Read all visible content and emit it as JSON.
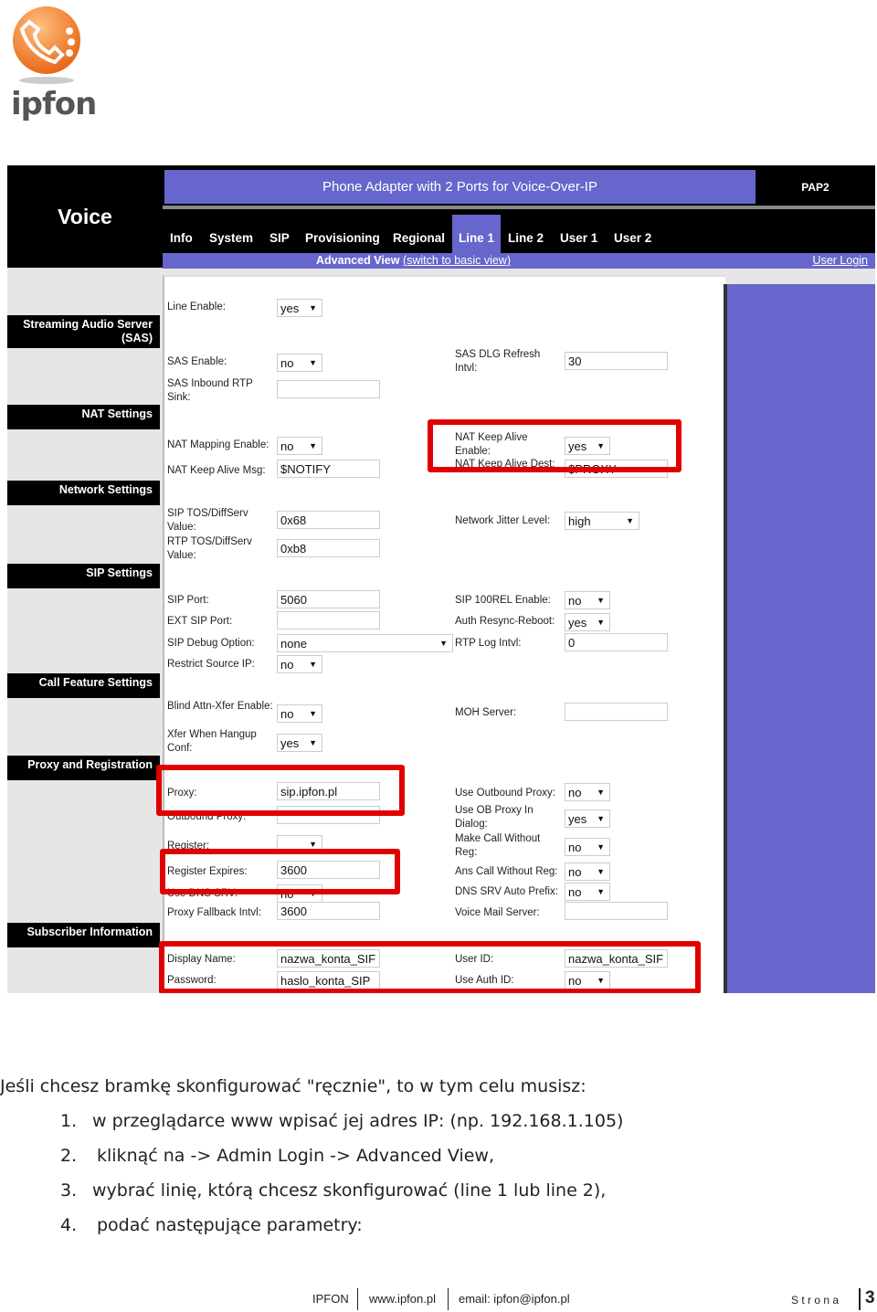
{
  "logo": {
    "text": "ipfon",
    "color": "#f08030"
  },
  "app": {
    "section_title": "Voice",
    "title": "Phone Adapter with 2 Ports for Voice-Over-IP",
    "model": "PAP2",
    "tabs": [
      {
        "label": "Info"
      },
      {
        "label": "System"
      },
      {
        "label": "SIP"
      },
      {
        "label": "Provisioning"
      },
      {
        "label": "Regional"
      },
      {
        "label": "Line 1",
        "active": true
      },
      {
        "label": "Line 2"
      },
      {
        "label": "User 1"
      },
      {
        "label": "User 2"
      }
    ],
    "view_label": "Advanced View",
    "switch_link": "(switch to basic view)",
    "user_login": "User Login",
    "accent": "#6666cc",
    "sections": [
      {
        "label": "Streaming Audio Server (SAS)"
      },
      {
        "label": "NAT Settings"
      },
      {
        "label": "Network Settings"
      },
      {
        "label": "SIP Settings"
      },
      {
        "label": "Call Feature Settings"
      },
      {
        "label": "Proxy and Registration"
      },
      {
        "label": "Subscriber Information"
      }
    ],
    "fields": [
      {
        "label": "Line Enable:",
        "value": "yes",
        "kind": "select"
      },
      {
        "label": "SAS Enable:",
        "value": "no",
        "kind": "select"
      },
      {
        "label": "SAS Inbound RTP Sink:",
        "value": "",
        "kind": "text"
      },
      {
        "label": "NAT Mapping Enable:",
        "value": "no",
        "kind": "select"
      },
      {
        "label": "NAT Keep Alive Msg:",
        "value": "$NOTIFY",
        "kind": "text"
      },
      {
        "label": "SIP TOS/DiffServ Value:",
        "value": "0x68",
        "kind": "text"
      },
      {
        "label": "RTP TOS/DiffServ Value:",
        "value": "0xb8",
        "kind": "text"
      },
      {
        "label": "SIP Port:",
        "value": "5060",
        "kind": "text"
      },
      {
        "label": "EXT SIP Port:",
        "value": "",
        "kind": "text"
      },
      {
        "label": "SIP Debug Option:",
        "value": "none",
        "kind": "select"
      },
      {
        "label": "Restrict Source IP:",
        "value": "no",
        "kind": "select"
      },
      {
        "label": "Blind Attn-Xfer Enable:",
        "value": "no",
        "kind": "select"
      },
      {
        "label": "Xfer When Hangup Conf:",
        "value": "yes",
        "kind": "select"
      },
      {
        "label": "Proxy:",
        "value": "sip.ipfon.pl",
        "kind": "text"
      },
      {
        "label": "Outbound Proxy:",
        "value": "",
        "kind": "text"
      },
      {
        "label": "Register:",
        "value": "",
        "kind": "select"
      },
      {
        "label": "Register Expires:",
        "value": "3600",
        "kind": "text"
      },
      {
        "label": "Use DNS SRV:",
        "value": "no",
        "kind": "select"
      },
      {
        "label": "Proxy Fallback Intvl:",
        "value": "3600",
        "kind": "text"
      },
      {
        "label": "Display Name:",
        "value": "nazwa_konta_SIF",
        "kind": "text"
      },
      {
        "label": "Password:",
        "value": "haslo_konta_SIP",
        "kind": "text"
      },
      {
        "label": "SAS DLG Refresh Intvl:",
        "value": "30",
        "kind": "text"
      },
      {
        "label": "NAT Keep Alive Enable:",
        "value": "yes",
        "kind": "select"
      },
      {
        "label": "NAT Keep Alive Dest:",
        "value": "$PROXY",
        "kind": "text"
      },
      {
        "label": "Network Jitter Level:",
        "value": "high",
        "kind": "select"
      },
      {
        "label": "SIP 100REL Enable:",
        "value": "no",
        "kind": "select"
      },
      {
        "label": "Auth Resync-Reboot:",
        "value": "yes",
        "kind": "select"
      },
      {
        "label": "RTP Log Intvl:",
        "value": "0",
        "kind": "text"
      },
      {
        "label": "MOH Server:",
        "value": "",
        "kind": "text"
      },
      {
        "label": "Use Outbound Proxy:",
        "value": "no",
        "kind": "select"
      },
      {
        "label": "Use OB Proxy In Dialog:",
        "value": "yes",
        "kind": "select"
      },
      {
        "label": "Make Call Without Reg:",
        "value": "no",
        "kind": "select"
      },
      {
        "label": "Ans Call Without Reg:",
        "value": "no",
        "kind": "select"
      },
      {
        "label": "DNS SRV Auto Prefix:",
        "value": "no",
        "kind": "select"
      },
      {
        "label": "Voice Mail Server:",
        "value": "",
        "kind": "text"
      },
      {
        "label": "User ID:",
        "value": "nazwa_konta_SIF",
        "kind": "text"
      },
      {
        "label": "Use Auth ID:",
        "value": "no",
        "kind": "select"
      }
    ],
    "highlight_color": "#e00000"
  },
  "instructions": {
    "intro": "Jeśli chcesz bramkę skonfigurować \"ręcznie\", to w tym celu musisz:",
    "steps": [
      {
        "num": "1.",
        "text": "w przeglądarce www wpisać jej adres IP: (np. 192.168.1.105)"
      },
      {
        "num": "2.",
        "text": "kliknąć na -> Admin Login -> Advanced View,"
      },
      {
        "num": "3.",
        "text": "wybrać linię, którą chcesz skonfigurować (line 1 lub line 2),"
      },
      {
        "num": "4.",
        "text": "podać następujące parametry:"
      }
    ]
  },
  "footer": {
    "company": "IPFON",
    "website": "www.ipfon.pl",
    "email": "email: ipfon@ipfon.pl",
    "page_label": "S t r o n a",
    "page_number": "3"
  }
}
